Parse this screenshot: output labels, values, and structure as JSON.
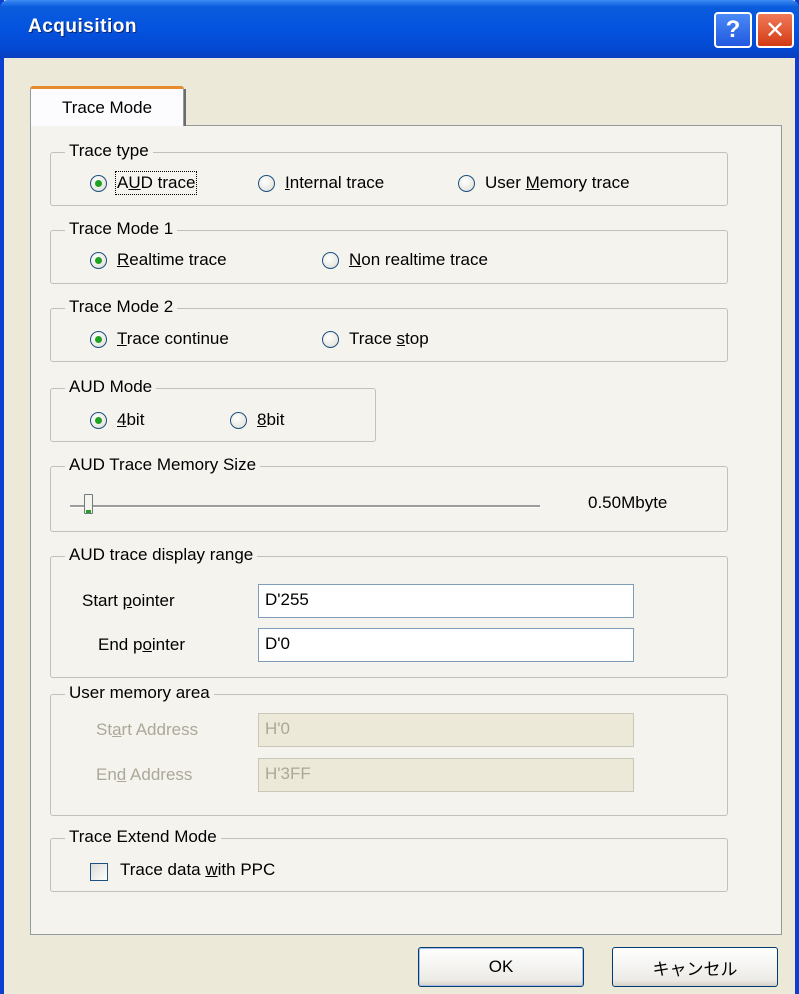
{
  "window": {
    "title": "Acquisition",
    "help_icon": "?",
    "close_icon": "✕"
  },
  "tabs": [
    {
      "label": "Trace Mode",
      "active": true
    }
  ],
  "trace_type": {
    "title": "Trace type",
    "options": [
      {
        "pre": "A",
        "ul": "U",
        "post": "D trace",
        "selected": true
      },
      {
        "pre": "",
        "ul": "I",
        "post": "nternal trace",
        "selected": false
      },
      {
        "pre": "User ",
        "ul": "M",
        "post": "emory trace",
        "selected": false
      }
    ]
  },
  "trace_mode_1": {
    "title": "Trace Mode 1",
    "options": [
      {
        "ul": "R",
        "post": "ealtime trace",
        "selected": true
      },
      {
        "ul": "N",
        "post": "on realtime trace",
        "selected": false
      }
    ]
  },
  "trace_mode_2": {
    "title": "Trace Mode 2",
    "options": [
      {
        "pre": "",
        "ul": "T",
        "post": "race continue",
        "selected": true
      },
      {
        "pre": "Trace ",
        "ul": "s",
        "post": "top",
        "selected": false
      }
    ]
  },
  "aud_mode": {
    "title": "AUD Mode",
    "options": [
      {
        "ul": "4",
        "post": "bit",
        "selected": true
      },
      {
        "ul": "8",
        "post": "bit",
        "selected": false
      }
    ]
  },
  "memory_size": {
    "title": "AUD Trace Memory Size",
    "value_text": "0.50Mbyte",
    "slider_position": 0.03
  },
  "display_range": {
    "title": "AUD trace display range",
    "start_label_pre": "Start ",
    "start_label_ul": "p",
    "start_label_post": "ointer",
    "start_value": "D'255",
    "end_label_pre": "End p",
    "end_label_ul": "o",
    "end_label_post": "inter",
    "end_value": "D'0"
  },
  "user_memory": {
    "title": "User memory area",
    "start_label_pre": "St",
    "start_label_ul": "a",
    "start_label_post": "rt Address",
    "start_value": "H'0",
    "end_label_pre": "En",
    "end_label_ul": "d",
    "end_label_post": " Address",
    "end_value": "H'3FF"
  },
  "extend_mode": {
    "title": "Trace Extend Mode",
    "checkbox_pre": "Trace data ",
    "checkbox_ul": "w",
    "checkbox_post": "ith PPC",
    "checked": false
  },
  "buttons": {
    "ok": "OK",
    "cancel": "キャンセル"
  },
  "colors": {
    "titlebar": "#0453e0",
    "face": "#ece9d8",
    "radio_dot": "#21a121",
    "tab_accent": "#e68b2c"
  }
}
